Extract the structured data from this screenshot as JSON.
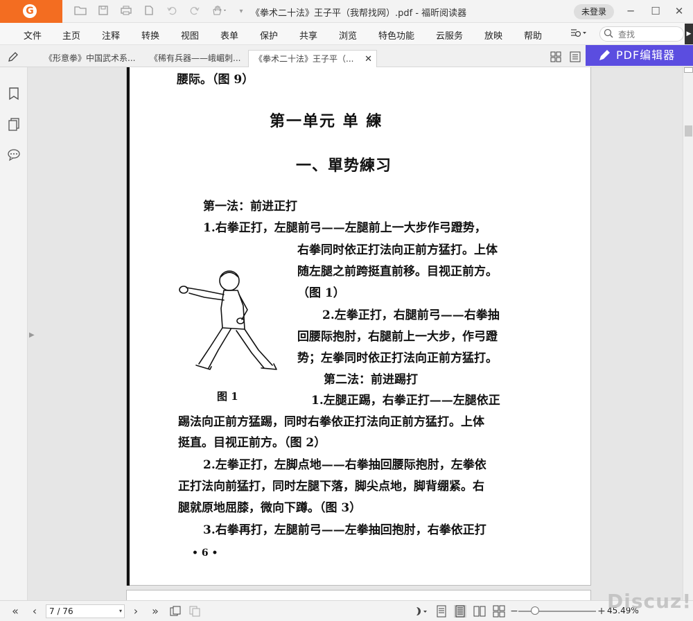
{
  "app": {
    "doc_title": "《拳术二十法》王子平（我帮找网）.pdf - 福昕阅读器",
    "login_label": "未登录"
  },
  "menu": {
    "items": [
      "文件",
      "主页",
      "注释",
      "转换",
      "视图",
      "表单",
      "保护",
      "共享",
      "浏览",
      "特色功能",
      "云服务",
      "放映",
      "帮助"
    ],
    "search_placeholder": "查找"
  },
  "tabs": [
    {
      "label": "《形意拳》中国武术系..."
    },
    {
      "label": "《稀有兵器——峨嵋刺..."
    },
    {
      "label": "《拳术二十法》王子平（..."
    }
  ],
  "pdf_editor_label": "PDF编辑器",
  "document": {
    "top_line": "腰际。（图 9）",
    "unit_title": "第一单元  单    練",
    "section_title": "一、單势練习",
    "method1_title": "第一法：前进正打",
    "lines": [
      "1.右拳正打，左腿前弓——左腿前上一大步作弓蹬势，",
      "右拳同时依正打法向正前方猛打。上体",
      "随左腿之前跨挺直前移。目视正前方。",
      "（图 1）",
      "2.左拳正打，右腿前弓——右拳抽",
      "回腰际抱肘，右腿前上一大步，作弓蹬",
      "势；左拳同时依正打法向正前方猛打。",
      "第二法：前进踢打",
      "1.左腿正踢，右拳正打——左腿依正",
      "踢法向正前方猛踢，同时右拳依正打法向正前方猛打。上体",
      "挺直。目视正前方。（图 2）",
      "2.左拳正打，左脚点地——右拳抽回腰际抱肘，左拳依",
      "正打法向前猛打，同时左腿下落，脚尖点地，脚背绷紧。右",
      "腿就原地屈膝，微向下蹲。（图 3）",
      "3.右拳再打，左腿前弓——左拳抽回抱肘，右拳依正打"
    ],
    "figure_caption": "图  1",
    "page_number": "• 6 •"
  },
  "status": {
    "page_indicator": "7 / 76",
    "zoom": "45.49%"
  },
  "watermark": "Discuz!"
}
